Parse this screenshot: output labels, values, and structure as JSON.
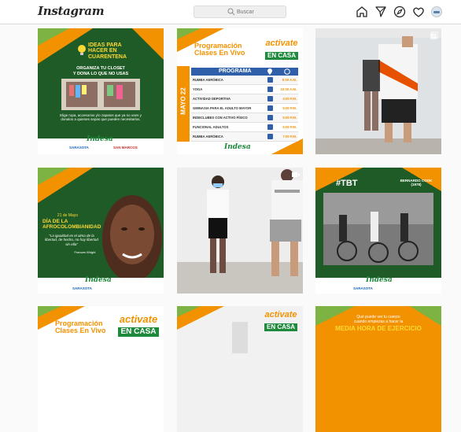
{
  "app": {
    "logo": "Instagram"
  },
  "search": {
    "placeholder": "Buscar"
  },
  "colors": {
    "orange": "#f39200",
    "green_dark": "#1b5e20",
    "green": "#2e7d32",
    "indesa_green": "#1e8a3c",
    "blue_table": "#2f5fa8"
  },
  "nav_icons": [
    "home-icon",
    "direct-icon",
    "explore-icon",
    "heart-icon",
    "avatar"
  ],
  "posts": {
    "p1": {
      "title_line1": "IDEAS PARA",
      "title_line2": "HACER EN",
      "title_line3": "CUARENTENA",
      "subtitle_line1": "ORGANIZA TU CLOSET",
      "subtitle_line2": "Y DONA LO QUE NO USAS",
      "body": "Elige ropa, accesorios y/o zapatos que ya no uses y donalos a quienes sepas que pueden necesitarlos.",
      "brand": "Indesa",
      "logo_left": "SARASOTA",
      "logo_right": "SAN MARCOS"
    },
    "p2": {
      "title_line1": "Programación",
      "title_line2": "Clases En Vivo",
      "badge_line1": "activate",
      "badge_line2": "EN CASA",
      "table_header": "PROGRAMA",
      "date_label": "MAYO 22",
      "rows": [
        {
          "activity": "RUMBA AERÓBICA",
          "time": "9:00 A.M."
        },
        {
          "activity": "YOGA",
          "time": "10:00 A.M."
        },
        {
          "activity": "ACTIVIDAD DEPORTIVA",
          "time": "4:00 P.M."
        },
        {
          "activity": "GIMNASIA PARA EL ADULTO MAYOR",
          "time": "5:00 P.M."
        },
        {
          "activity": "INDECLUBES CON ACTIVO FÍSICO",
          "time": "5:00 P.M."
        },
        {
          "activity": "FUNCIONAL ADULTOS",
          "time": "6:00 P.M."
        },
        {
          "activity": "RUMBA AERÓBICA",
          "time": "7:00 P.M."
        }
      ],
      "brand": "Indesa"
    },
    "p4": {
      "date": "21 de Mayo",
      "title_line1": "DÍA DE LA",
      "title_line2": "AFROCOLOMBIANIDAD",
      "quote": "\"La igualdad es el alma de la libertad, de hecho, no hay libertad sin ella\"",
      "author": "Frances Wright",
      "brand": "Indesa",
      "logo_left": "SARASOTA"
    },
    "p6": {
      "tag": "#TBT",
      "caption_line1": "BERNARDO COOK",
      "caption_line2": "(1978)",
      "brand": "Indesa",
      "logo_left": "SARASOTA"
    },
    "p7": {
      "title_line1": "Programación",
      "title_line2": "Clases En Vivo",
      "badge_line1": "activate",
      "badge_line2": "EN CASA"
    },
    "p8": {
      "badge_line1": "activate",
      "badge_line2": "EN CASA"
    },
    "p9": {
      "text_line1": "Qué puede ver tu cuerpo",
      "text_line2": "cuando empiezas a hacer la",
      "text_line3": "MEDIA HORA DE EJERCICIO"
    }
  }
}
